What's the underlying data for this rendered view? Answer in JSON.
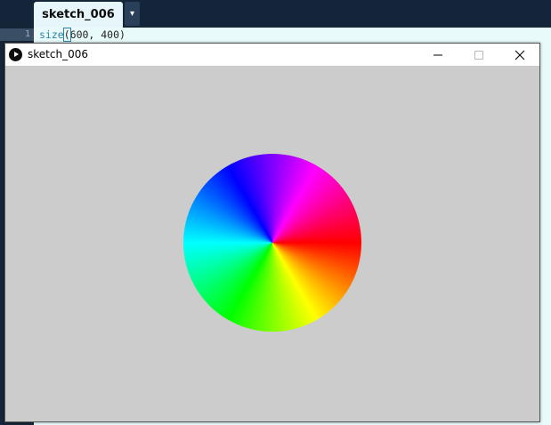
{
  "editor": {
    "tab_label": "sketch_006",
    "tab_menu_icon": "▾",
    "line_number": "1",
    "code": {
      "function": "size",
      "open_paren": "(",
      "args": "600, 400)"
    }
  },
  "sketch_window": {
    "title": "sketch_006",
    "icon": "processing-play-icon",
    "controls": [
      "minimize-icon",
      "maximize-icon",
      "close-icon"
    ],
    "canvas": {
      "background": "#cccccc",
      "shape": "hue-color-wheel",
      "colors": [
        "#ff0000",
        "#ffff00",
        "#00ff00",
        "#00ffff",
        "#0000ff",
        "#ff00ff"
      ]
    }
  }
}
